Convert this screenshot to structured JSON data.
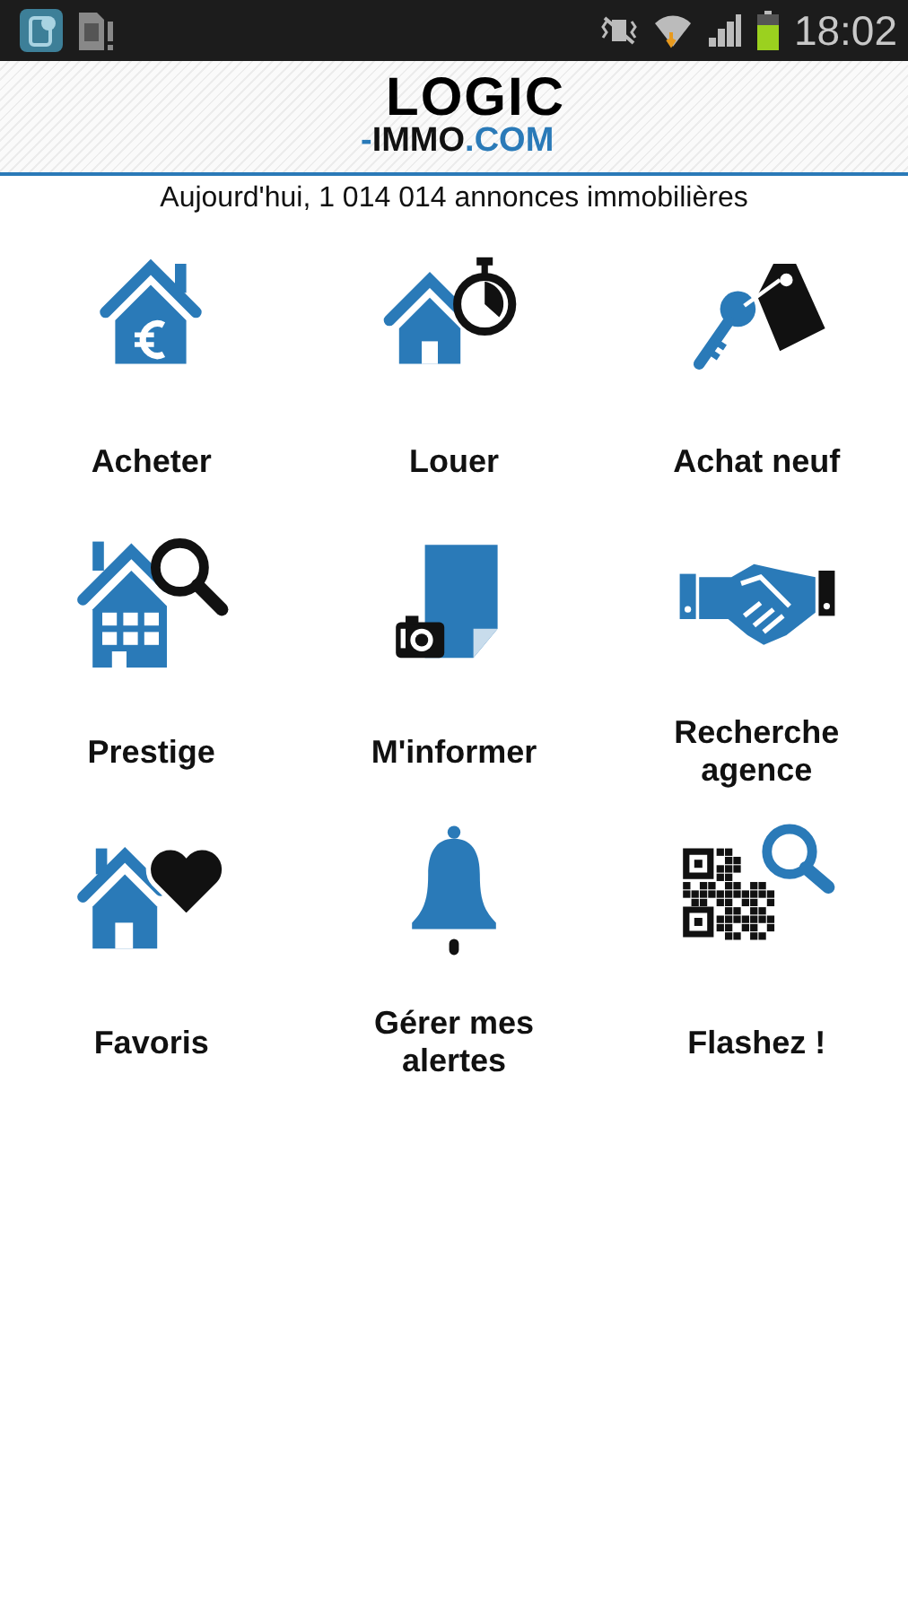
{
  "status_bar": {
    "time": "18:02"
  },
  "header": {
    "logo": {
      "word": "LOGIC",
      "dash": "-",
      "immo": "IMMO",
      "tld": ".COM"
    }
  },
  "tagline": "Aujourd'hui, 1 014 014 annonces immobilières",
  "tiles": [
    {
      "label": "Acheter",
      "kind": "buy"
    },
    {
      "label": "Louer",
      "kind": "rent"
    },
    {
      "label": "Achat neuf",
      "kind": "new"
    },
    {
      "label": "Prestige",
      "kind": "prestige"
    },
    {
      "label": "M'informer",
      "kind": "inform"
    },
    {
      "label": "Recherche agence",
      "kind": "agency"
    },
    {
      "label": "Favoris",
      "kind": "favorites"
    },
    {
      "label": "Gérer mes alertes",
      "kind": "alerts"
    },
    {
      "label": "Flashez !",
      "kind": "flash"
    }
  ]
}
